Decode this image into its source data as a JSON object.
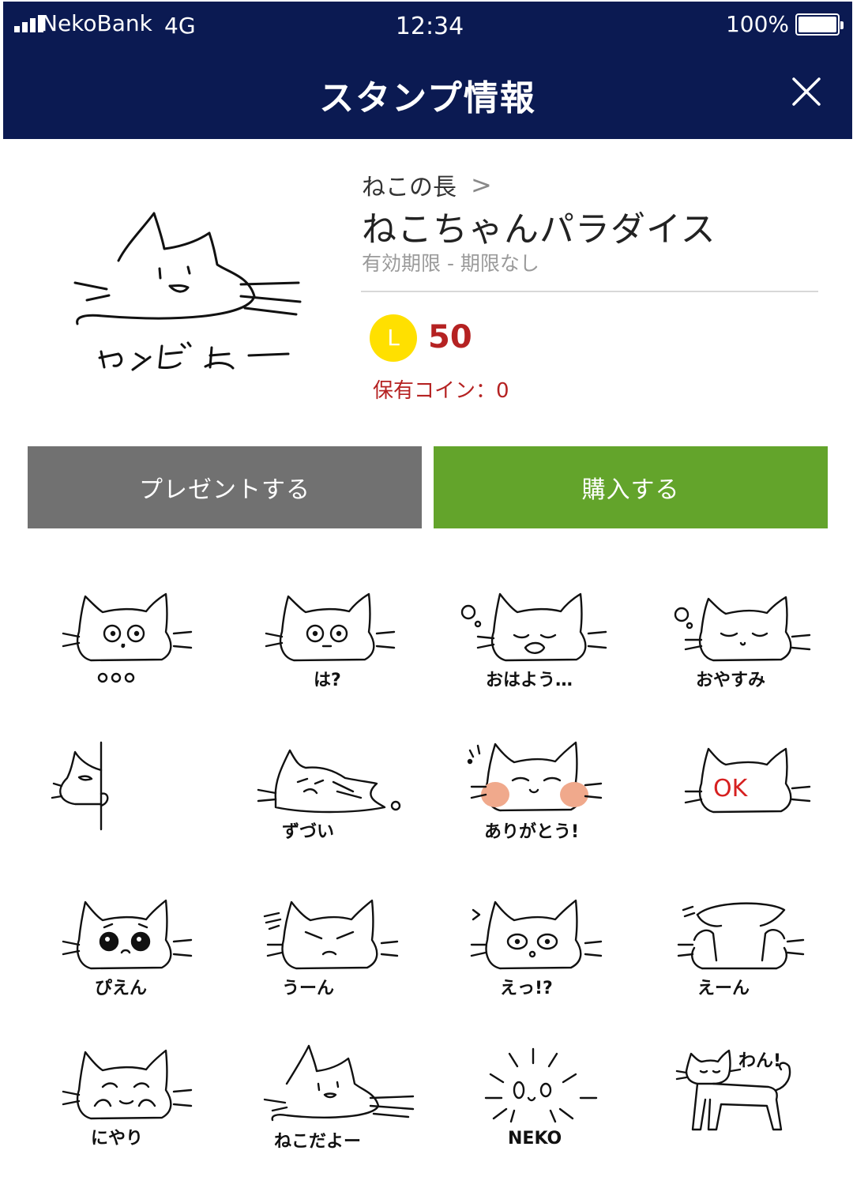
{
  "status_bar": {
    "carrier": "NekoBank",
    "network": "4G",
    "time": "12:34",
    "battery": "100%",
    "battery_level": 1.0
  },
  "header": {
    "title": "スタンプ情報"
  },
  "pack": {
    "author": "ねこの長",
    "author_chevron": ">",
    "title": "ねこちゃんパラダイス",
    "validity": "有効期限 - 期限なし",
    "main_sticker_caption": "ねこだよー",
    "coin_symbol": "L",
    "price": "50",
    "owned_coins": "保有コイン：0"
  },
  "buttons": {
    "gift": "プレゼントする",
    "buy": "購入する"
  },
  "colors": {
    "header_bg": "#0b1a52",
    "gift_button": "#717171",
    "buy_button": "#63a42b",
    "price": "#b52222",
    "coin": "#ffe000"
  },
  "stickers": [
    {
      "caption": "ooo"
    },
    {
      "caption": "は?"
    },
    {
      "caption": "おはよう…"
    },
    {
      "caption": "おやすみ"
    },
    {
      "caption": ""
    },
    {
      "caption": "ずづい"
    },
    {
      "caption": "ありがとう!"
    },
    {
      "caption": "OK"
    },
    {
      "caption": "ぴえん"
    },
    {
      "caption": "うーん"
    },
    {
      "caption": "えっ!?"
    },
    {
      "caption": "えーん"
    },
    {
      "caption": "にやり"
    },
    {
      "caption": "ねこだよー"
    },
    {
      "caption": "NEKO"
    },
    {
      "caption": "わん!"
    }
  ]
}
